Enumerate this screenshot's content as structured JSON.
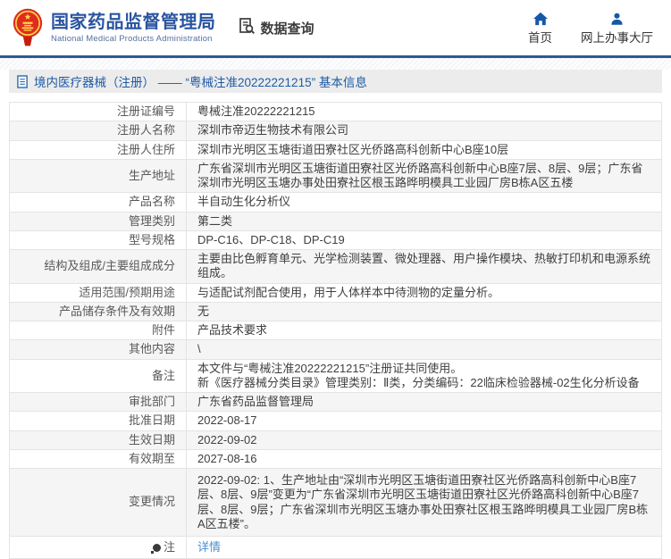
{
  "header": {
    "agency_cn": "国家药品监督管理局",
    "agency_en": "National Medical Products Administration",
    "section_label": "数据查询",
    "nav": [
      {
        "label": "首页",
        "icon": "home-icon"
      },
      {
        "label": "网上办事大厅",
        "icon": "user-icon"
      }
    ]
  },
  "breadcrumb": {
    "text": "境内医疗器械（注册） ——  “粤械注准20222221215”  基本信息"
  },
  "colors": {
    "accent_blue": "#2a54a0",
    "nav_icon_blue": "#1558a6",
    "link_blue": "#4a90d2",
    "divider_blue": "#2a5b94",
    "breadcrumb_bg": "#ececec",
    "stripe_bg": "#f5f5f5",
    "emblem_red": "#e02b1d",
    "emblem_gold": "#fbd64b"
  },
  "table": {
    "rows": [
      {
        "label": "注册证编号",
        "lines": [
          "粤械注准20222221215"
        ]
      },
      {
        "label": "注册人名称",
        "lines": [
          "深圳市帝迈生物技术有限公司"
        ]
      },
      {
        "label": "注册人住所",
        "lines": [
          "深圳市光明区玉塘街道田寮社区光侨路高科创新中心B座10层"
        ]
      },
      {
        "label": "生产地址",
        "lines": [
          "广东省深圳市光明区玉塘街道田寮社区光侨路高科创新中心B座7层、8层、9层；广东省深圳市光明区玉塘办事处田寮社区根玉路晔明模具工业园厂房B栋A区五楼"
        ]
      },
      {
        "label": "产品名称",
        "lines": [
          "半自动生化分析仪"
        ]
      },
      {
        "label": "管理类别",
        "lines": [
          "第二类"
        ]
      },
      {
        "label": "型号规格",
        "lines": [
          "DP-C16、DP-C18、DP-C19"
        ]
      },
      {
        "label": "结构及组成/主要组成成分",
        "lines": [
          "主要由比色孵育单元、光学检测装置、微处理器、用户操作模块、热敏打印机和电源系统组成。"
        ]
      },
      {
        "label": "适用范围/预期用途",
        "lines": [
          "与适配试剂配合使用，用于人体样本中待测物的定量分析。"
        ]
      },
      {
        "label": "产品储存条件及有效期",
        "lines": [
          "无"
        ]
      },
      {
        "label": "附件",
        "lines": [
          "产品技术要求"
        ]
      },
      {
        "label": "其他内容",
        "lines": [
          "\\"
        ]
      },
      {
        "label": "备注",
        "lines": [
          "本文件与“粤械注准20222221215”注册证共同使用。",
          "新《医疗器械分类目录》管理类别：Ⅱ类，分类编码：22临床检验器械-02生化分析设备"
        ]
      },
      {
        "label": "审批部门",
        "lines": [
          "广东省药品监督管理局"
        ]
      },
      {
        "label": "批准日期",
        "lines": [
          "2022-08-17"
        ]
      },
      {
        "label": "生效日期",
        "lines": [
          "2022-09-02"
        ]
      },
      {
        "label": "有效期至",
        "lines": [
          "2027-08-16"
        ]
      },
      {
        "label": "变更情况",
        "tall": true,
        "lines": [
          "2022-09-02: 1、生产地址由“深圳市光明区玉塘街道田寮社区光侨路高科创新中心B座7层、8层、9层”变更为“广东省深圳市光明区玉塘街道田寮社区光侨路高科创新中心B座7层、8层、9层；广东省深圳市光明区玉塘办事处田寮社区根玉路晔明模具工业园厂房B栋A区五楼”。"
        ]
      },
      {
        "label": "注",
        "label_icon": "bulb-note-icon",
        "note": true,
        "link": true,
        "lines": [
          "详情"
        ]
      }
    ]
  }
}
